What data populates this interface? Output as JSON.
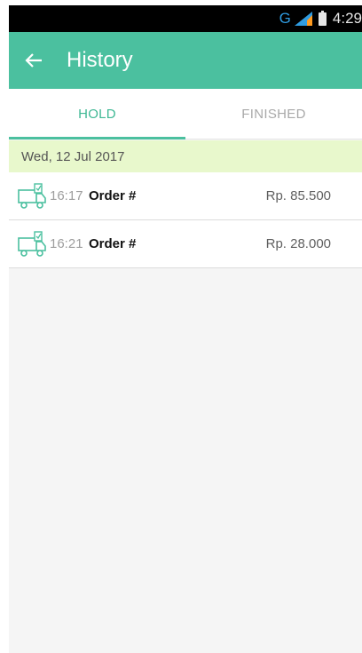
{
  "status_bar": {
    "network_type": "G",
    "time": "4:29",
    "icons": [
      "network-type-icon",
      "signal-icon",
      "battery-icon"
    ]
  },
  "app_bar": {
    "back_icon": "arrow-left-icon",
    "title": "History"
  },
  "tabs": [
    {
      "label": "HOLD",
      "active": true
    },
    {
      "label": "FINISHED",
      "active": false
    }
  ],
  "date_header": "Wed, 12 Jul 2017",
  "orders": [
    {
      "icon": "delivery-truck-icon",
      "time": "16:17",
      "label": "Order #",
      "amount": "Rp. 85.500"
    },
    {
      "icon": "delivery-truck-icon",
      "time": "16:21",
      "label": "Order #",
      "amount": "Rp. 28.000"
    }
  ],
  "colors": {
    "primary": "#4bc09f",
    "tab_active": "#3fb894",
    "tab_inactive": "#a9a9a9",
    "date_header_bg": "#e8f8cc",
    "status_bar_bg": "#000000",
    "network_type": "#2f9be0"
  }
}
